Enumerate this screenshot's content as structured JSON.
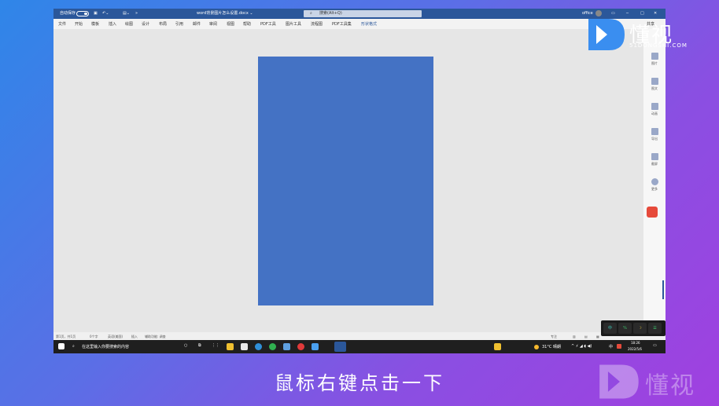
{
  "titlebar": {
    "autosave": "自动保存",
    "doc_title": "word背景图片怎么设置.docx ⌄",
    "search_placeholder": "搜索(Alt+Q)",
    "office_label": "office",
    "minimize": "─",
    "restore": "□",
    "close": "✕"
  },
  "menu": [
    "文件",
    "开始",
    "模板",
    "插入",
    "绘图",
    "设计",
    "布局",
    "引用",
    "邮件",
    "审阅",
    "视图",
    "帮助",
    "PDF工具",
    "图片工具",
    "流程图",
    "PDF工具集",
    "形状格式"
  ],
  "share_label": "共享",
  "side_panel": [
    "图片",
    "图文",
    "动画",
    "导出",
    "截屏",
    "更多"
  ],
  "status": {
    "page": "第1页，共1页",
    "words": "0个字",
    "lang": "英语(美国)",
    "insert": "插入",
    "accessibility": "辅助功能: 调查",
    "focus": "专注"
  },
  "taskbar": {
    "search_text": "在这里输入你要搜索的内容",
    "weather": "31°C 晴朗",
    "lang": "中",
    "time": "18:26",
    "date": "2022/5/6"
  },
  "tray_buttons": [
    "中",
    "⁰⁄₀",
    "☽",
    "☰"
  ],
  "caption": "鼠标右键点击一下",
  "logo": {
    "text": "懂视",
    "sub": "51DONGSHI.COM"
  },
  "watermark": "懂视"
}
